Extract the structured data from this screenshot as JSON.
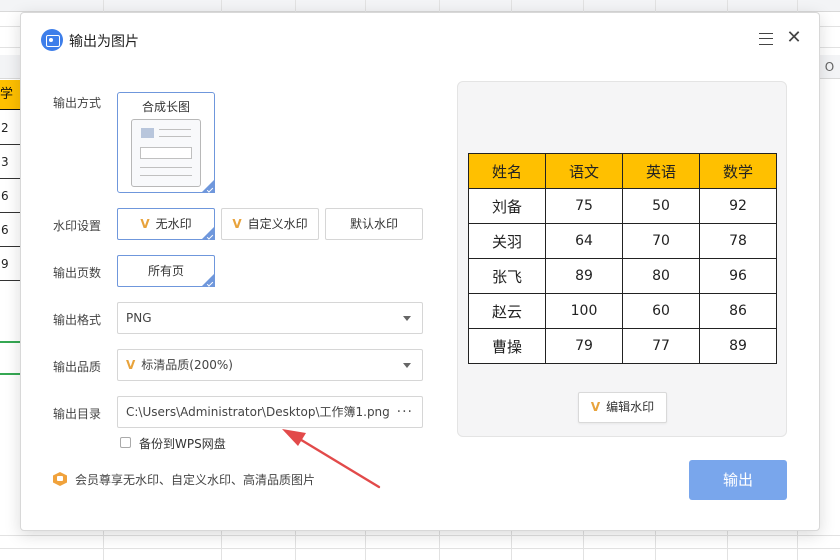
{
  "background": {
    "left_column_header": "学",
    "left_column_cells": [
      "2",
      "3",
      "6",
      "6",
      "9"
    ],
    "right_column_header": "O"
  },
  "dialog": {
    "title": "输出为图片",
    "rows": {
      "output_mode": {
        "label": "输出方式",
        "option": "合成长图"
      },
      "watermark": {
        "label": "水印设置",
        "options": [
          "无水印",
          "自定义水印",
          "默认水印"
        ],
        "selected": "无水印"
      },
      "pages": {
        "label": "输出页数",
        "option": "所有页"
      },
      "format": {
        "label": "输出格式",
        "value": "PNG"
      },
      "quality": {
        "label": "输出品质",
        "value": "标清品质(200%)"
      },
      "directory": {
        "label": "输出目录",
        "value": "C:\\Users\\Administrator\\Desktop\\工作簿1.png",
        "more": "···"
      }
    },
    "backup_checkbox_label": "备份到WPS网盘",
    "vip_note": "会员尊享无水印、自定义水印、高清品质图片",
    "vip_mark": "V",
    "preview": {
      "headers": [
        "姓名",
        "语文",
        "英语",
        "数学"
      ],
      "rows": [
        [
          "刘备",
          "75",
          "50",
          "92"
        ],
        [
          "关羽",
          "64",
          "70",
          "78"
        ],
        [
          "张飞",
          "89",
          "80",
          "96"
        ],
        [
          "赵云",
          "100",
          "60",
          "86"
        ],
        [
          "曹操",
          "79",
          "77",
          "89"
        ]
      ],
      "header_color": "#ffc000",
      "edit_watermark_label": "编辑水印"
    },
    "export_label": "输出",
    "accent_color": "#6f97dc",
    "export_color": "#79a6ec",
    "arrow_color": "#e24a4a"
  }
}
